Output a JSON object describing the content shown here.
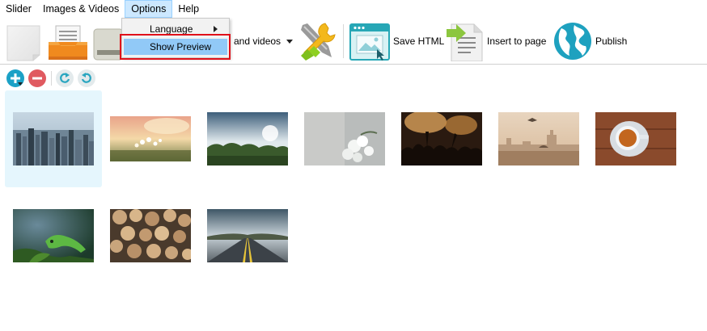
{
  "menubar": {
    "items": [
      "Slider",
      "Images & Videos",
      "Options",
      "Help"
    ],
    "active_index": 2
  },
  "toolbar": {
    "images_videos_label": "and videos",
    "save_html_label": "Save HTML",
    "insert_label": "Insert to page",
    "publish_label": "Publish"
  },
  "options_menu": {
    "language_label": "Language",
    "show_preview_label": "Show Preview"
  },
  "colors": {
    "accent": "#91c9f7",
    "highlight_border": "#e0101a",
    "add_button": "#1ba1c6",
    "remove_button": "#e05a60",
    "selected_bg": "#e5f6fd"
  },
  "gallery": {
    "items": [
      {
        "name": "city-skyline",
        "selected": true
      },
      {
        "name": "flowers-sunset",
        "selected": false
      },
      {
        "name": "forest-sky",
        "selected": false
      },
      {
        "name": "white-flowers",
        "selected": false
      },
      {
        "name": "concert-crowd",
        "selected": false
      },
      {
        "name": "london-bird",
        "selected": false
      },
      {
        "name": "coffee-cup",
        "selected": false
      },
      {
        "name": "iguana",
        "selected": false
      },
      {
        "name": "wood-logs",
        "selected": false
      },
      {
        "name": "road",
        "selected": false
      }
    ]
  }
}
